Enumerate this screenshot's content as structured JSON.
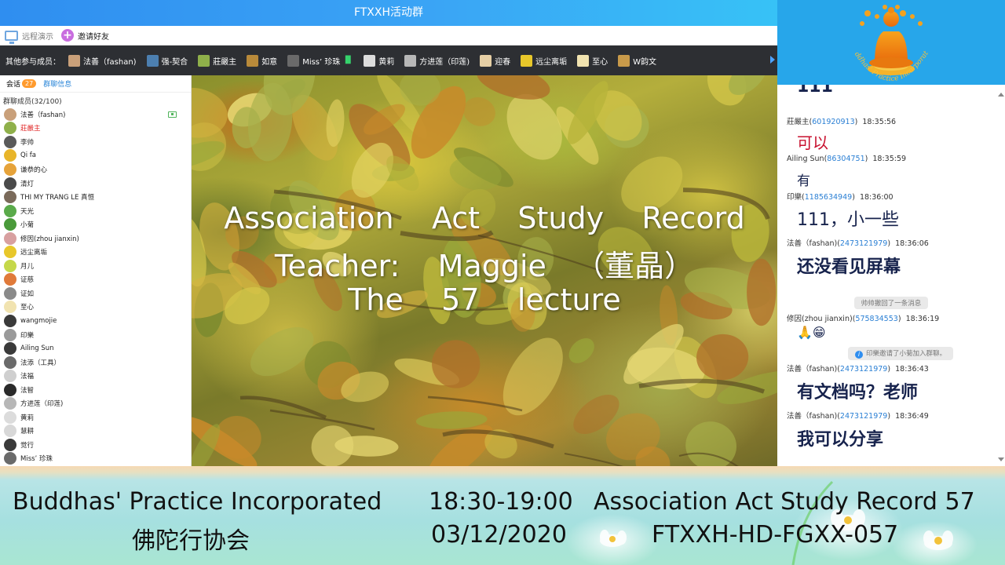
{
  "window": {
    "title": "FTXXH活动群"
  },
  "toolbar": {
    "remote_demo": "远程演示",
    "invite_friends": "邀请好友"
  },
  "members_bar": {
    "label": "其他参与成员：",
    "members": [
      {
        "name": "法善（fashan)",
        "color": "#c9a07a",
        "mic": false
      },
      {
        "name": "强-契合",
        "color": "#4c7fb0",
        "mic": false
      },
      {
        "name": "莊嚴主",
        "color": "#8fb04a",
        "mic": false
      },
      {
        "name": "如意",
        "color": "#b98a3a",
        "mic": false
      },
      {
        "name": "Miss’ 珍珠",
        "color": "#6a6a6a",
        "mic": true
      },
      {
        "name": "黄莉",
        "color": "#dcdcdc",
        "mic": false
      },
      {
        "name": "方进莲（印莲)",
        "color": "#b7b7b7",
        "mic": false
      },
      {
        "name": "迎春",
        "color": "#e6cfa5",
        "mic": false
      },
      {
        "name": "远尘离垢",
        "color": "#e8c72a",
        "mic": false
      },
      {
        "name": "至心",
        "color": "#f1e3b0",
        "mic": false
      },
      {
        "name": "W韵文",
        "color": "#c89a4a",
        "mic": false
      }
    ]
  },
  "sidebar": {
    "tab_chat": "会话",
    "tab_chat_badge": "27",
    "tab_info": "群聊信息",
    "group_count": "群聊成员(32/100)",
    "members": [
      {
        "name": "法善（fashan)",
        "color": "#c9a07a"
      },
      {
        "name": "莊嚴主",
        "color": "#8fb04a"
      },
      {
        "name": "李帅",
        "color": "#5a5a5a"
      },
      {
        "name": "Qi fa",
        "color": "#e8b52a"
      },
      {
        "name": "谦恭的心",
        "color": "#e6a33a"
      },
      {
        "name": "清灯",
        "color": "#4a4a4a"
      },
      {
        "name": "THI MY TRANG LE 真恒",
        "color": "#7a6a5a"
      },
      {
        "name": "天光",
        "color": "#5aaa4a"
      },
      {
        "name": "小菊",
        "color": "#4a9a3a"
      },
      {
        "name": "修因(zhou jianxin)",
        "color": "#d8a0a0"
      },
      {
        "name": "远尘离垢",
        "color": "#e8c72a"
      },
      {
        "name": "月儿",
        "color": "#c5d84a"
      },
      {
        "name": "证慈",
        "color": "#e07a3a"
      },
      {
        "name": "证如",
        "color": "#8a8a8a"
      },
      {
        "name": "至心",
        "color": "#f1e3b0"
      },
      {
        "name": "wangmojie",
        "color": "#3a3a3a"
      },
      {
        "name": "印樂",
        "color": "#9a9a9a"
      },
      {
        "name": "Ailing Sun",
        "color": "#3a3a3a"
      },
      {
        "name": "法添（工具）",
        "color": "#6a6a6a"
      },
      {
        "name": "法福",
        "color": "#cfcfcf"
      },
      {
        "name": "法智",
        "color": "#2a2a2a"
      },
      {
        "name": "方进莲（印莲)",
        "color": "#b7b7b7"
      },
      {
        "name": "黄莉",
        "color": "#dcdcdc"
      },
      {
        "name": "慧耕",
        "color": "#d8d8d8"
      },
      {
        "name": "觉行",
        "color": "#3a3a3a"
      },
      {
        "name": "Miss’ 珍珠",
        "color": "#6a6a6a"
      }
    ]
  },
  "slide": {
    "line1": "Association    Act    Study    Record",
    "line2": "Teacher:    Maggie   （董晶）",
    "line3": "The    57    lecture"
  },
  "chat": {
    "top_partial": "111",
    "messages": [
      {
        "sender": "莊嚴主",
        "qq": "601920913",
        "time": "18:35:56",
        "text": "可以",
        "style": "red"
      },
      {
        "sender": "Ailing Sun",
        "qq": "86304751",
        "time": "18:35:59",
        "text": "有",
        "style": "normal"
      },
      {
        "sender": "印樂",
        "qq": "1185634949",
        "time": "18:36:00",
        "text": "111，小一些",
        "style": "normal"
      },
      {
        "sender": "法善（fashan)",
        "qq": "2473121979",
        "time": "18:36:06",
        "text": "还没看见屏幕",
        "style": "big"
      },
      {
        "sender": "修因(zhou jianxin)",
        "qq": "575834553",
        "time": "18:36:19",
        "text": "🙏😁",
        "style": "emoji"
      },
      {
        "sender": "法善（fashan)",
        "qq": "2473121979",
        "time": "18:36:43",
        "text": "有文档吗？老师",
        "style": "big"
      },
      {
        "sender": "法善（fashan)",
        "qq": "2473121979",
        "time": "18:36:49",
        "text": "我可以分享",
        "style": "big"
      }
    ],
    "system_recall": "帅帅撤回了一条消息",
    "system_invite": "印樂邀请了小菊加入群聊。"
  },
  "logo": {
    "text": "Buddhas' Practice Incorporated"
  },
  "banner": {
    "org_en": "Buddhas' Practice Incorporated",
    "org_cn": "佛陀行协会",
    "time": "18:30-19:00",
    "date": "03/12/2020",
    "record": "Association Act Study Record 57",
    "code": "FTXXH-HD-FGXX-057"
  }
}
